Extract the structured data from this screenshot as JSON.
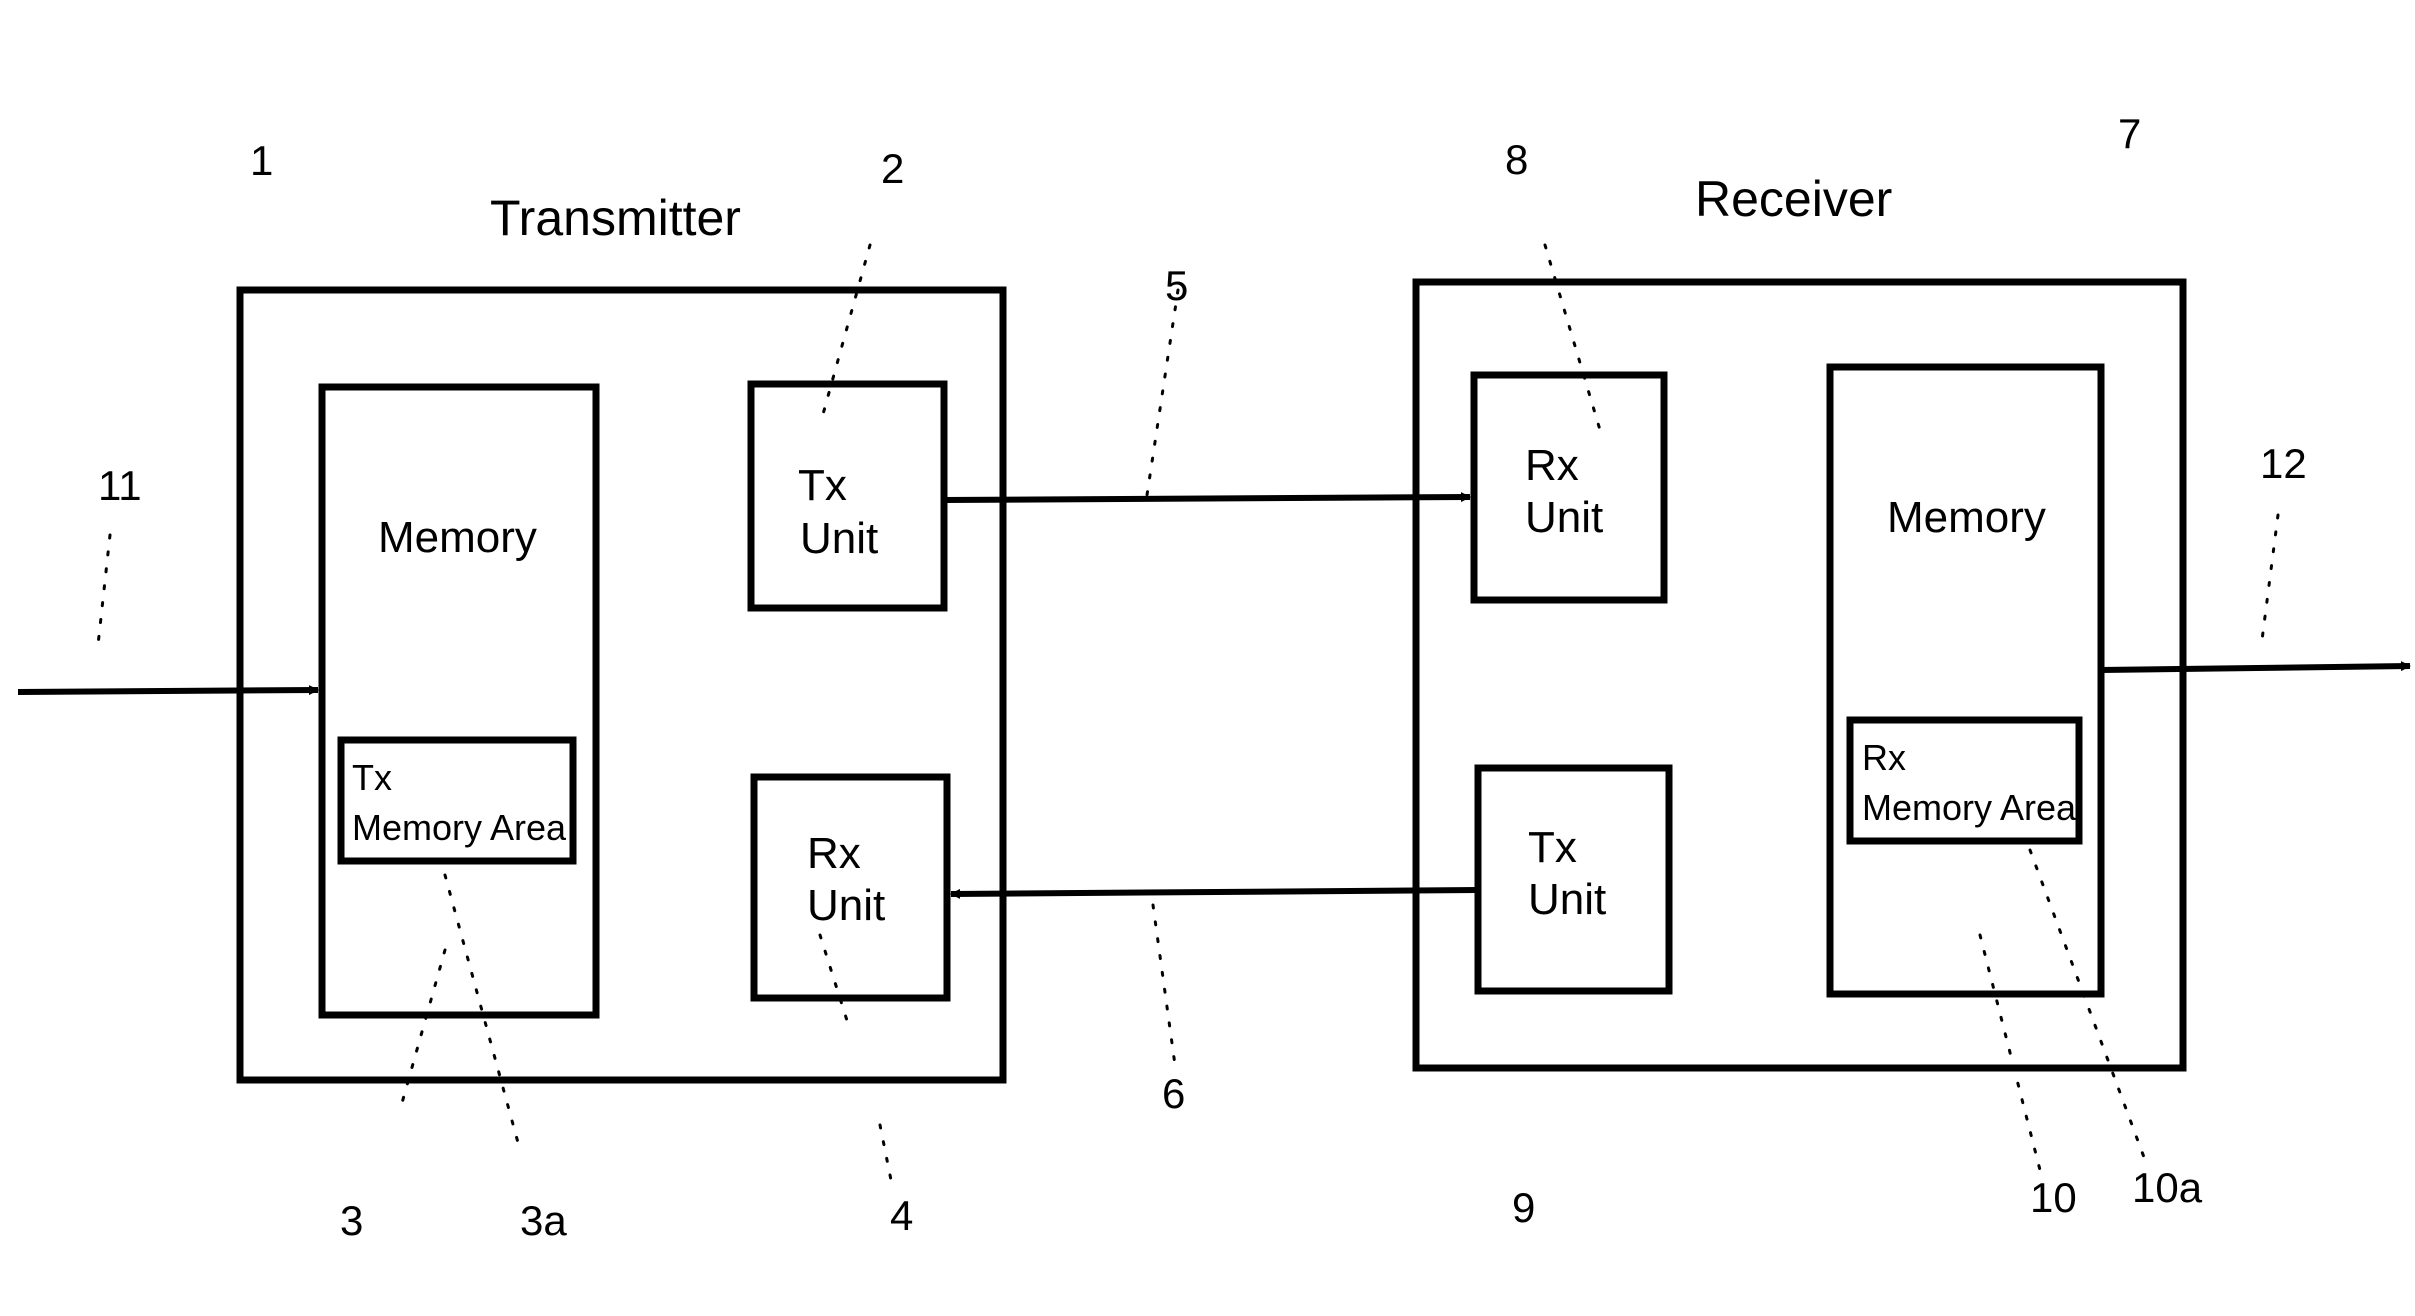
{
  "diagram": {
    "transmitter": {
      "title": "Transmitter",
      "ref": "1",
      "memory": {
        "label": "Memory",
        "ref": "3"
      },
      "memory_area": {
        "line1": "Tx",
        "line2": "Memory Area",
        "ref": "3a"
      },
      "tx_unit": {
        "line1": "Tx",
        "line2": "Unit",
        "ref": "2"
      },
      "rx_unit": {
        "line1": "Rx",
        "line2": "Unit",
        "ref": "4"
      }
    },
    "receiver": {
      "title": "Receiver",
      "ref": "7",
      "rx_unit": {
        "line1": "Rx",
        "line2": "Unit",
        "ref": "8"
      },
      "tx_unit": {
        "line1": "Tx",
        "line2": "Unit",
        "ref": "9"
      },
      "memory": {
        "label": "Memory",
        "ref": "10"
      },
      "memory_area": {
        "line1": "Rx",
        "line2": "Memory Area",
        "ref": "10a"
      }
    },
    "links": {
      "forward_ref": "5",
      "reverse_ref": "6",
      "input_ref": "11",
      "output_ref": "12"
    }
  }
}
